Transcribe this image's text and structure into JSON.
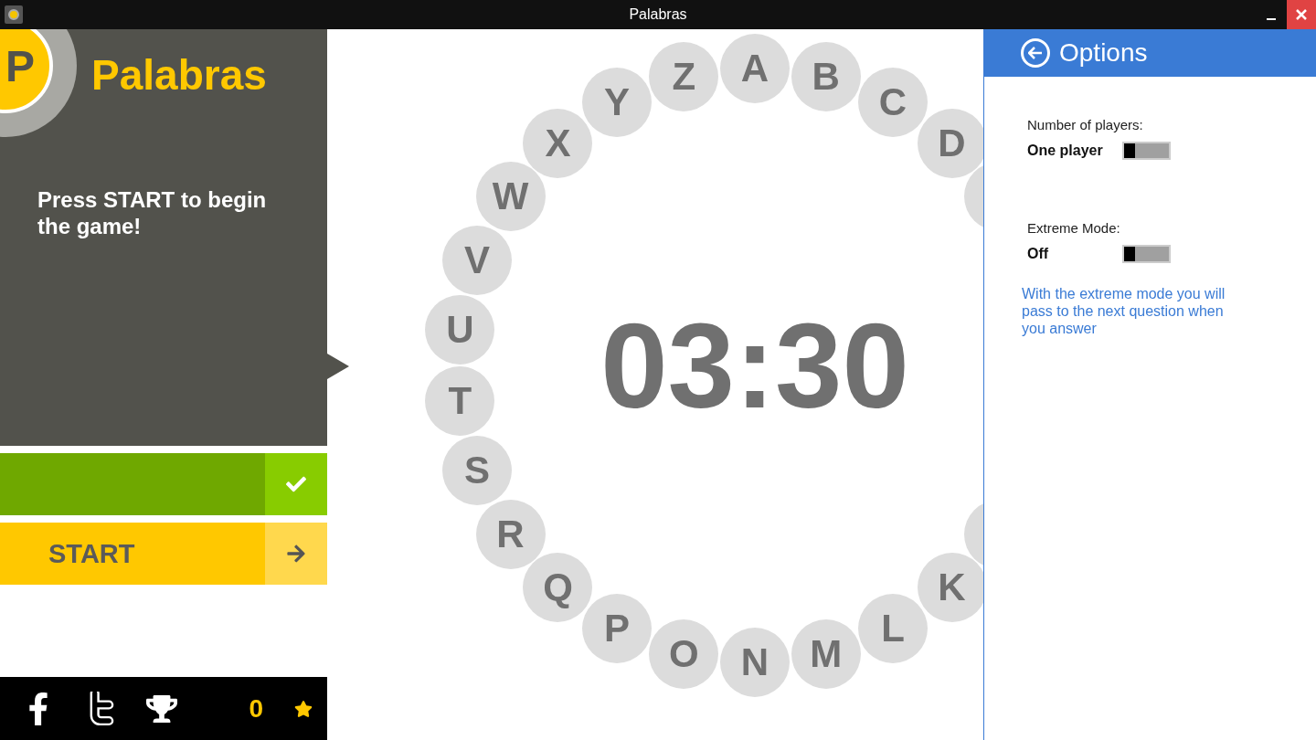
{
  "window": {
    "title": "Palabras"
  },
  "sidebar": {
    "logo_letter": "P",
    "app_name": "Palabras",
    "message": "Press START to begin the game!",
    "start_button": {
      "label": "START"
    },
    "score": "0"
  },
  "wheel": {
    "letters": [
      {
        "letter": "Z"
      },
      {
        "letter": "A"
      },
      {
        "letter": "B"
      },
      {
        "letter": "Y"
      },
      {
        "letter": "C"
      },
      {
        "letter": "X"
      },
      {
        "letter": "D"
      },
      {
        "letter": "W"
      },
      {
        "letter": "V"
      },
      {
        "letter": "U"
      },
      {
        "letter": "T"
      },
      {
        "letter": "S"
      },
      {
        "letter": "R"
      },
      {
        "letter": "Q"
      },
      {
        "letter": "K"
      },
      {
        "letter": "P"
      },
      {
        "letter": "L"
      },
      {
        "letter": "O"
      },
      {
        "letter": "N"
      },
      {
        "letter": "M"
      }
    ],
    "timer": "03:30"
  },
  "options": {
    "title": "Options",
    "settings": [
      {
        "label": "Number of players:",
        "value": "One player",
        "on": false
      },
      {
        "label": "Extreme Mode:",
        "value": "Off",
        "on": false
      }
    ],
    "note": "With the extreme mode you will pass to the next question when you answer"
  }
}
